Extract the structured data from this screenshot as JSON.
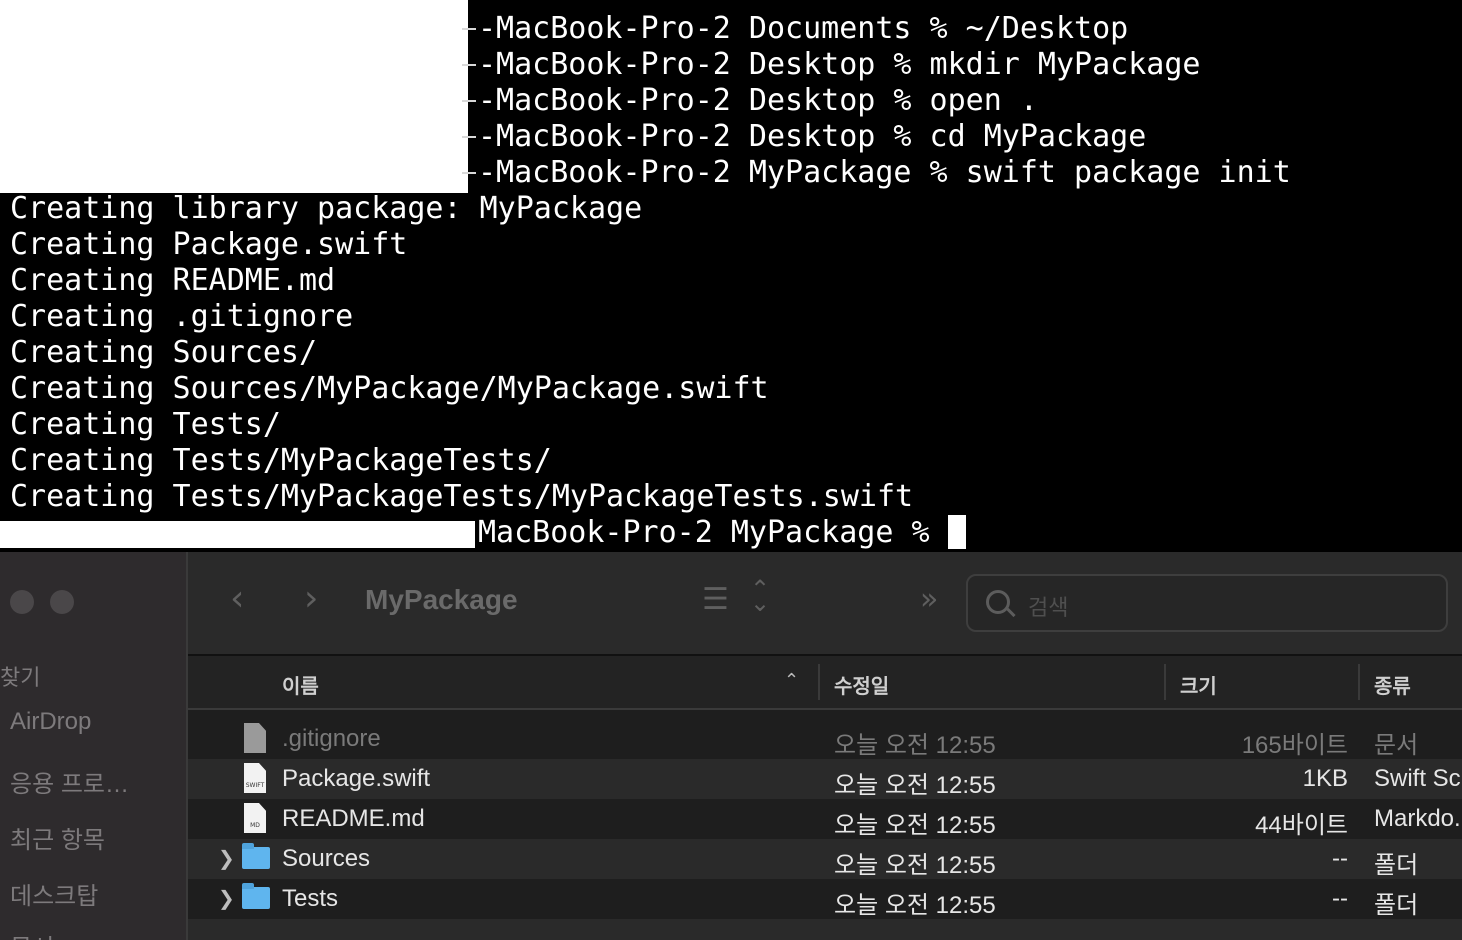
{
  "terminal": {
    "prompt_lines": [
      "-MacBook-Pro-2 Documents % ~/Desktop",
      "-MacBook-Pro-2 Desktop % mkdir MyPackage",
      "-MacBook-Pro-2 Desktop % open .",
      "-MacBook-Pro-2 Desktop % cd MyPackage",
      "-MacBook-Pro-2 MyPackage % swift package init"
    ],
    "output_lines": [
      "Creating library package: MyPackage",
      "Creating Package.swift",
      "Creating README.md",
      "Creating .gitignore",
      "Creating Sources/",
      "Creating Sources/MyPackage/MyPackage.swift",
      "Creating Tests/",
      "Creating Tests/MyPackageTests/",
      "Creating Tests/MyPackageTests/MyPackageTests.swift"
    ],
    "last_prompt": "MacBook-Pro-2 MyPackage %"
  },
  "finder": {
    "sidebar": {
      "heading": "찾기",
      "items": [
        "AirDrop",
        "응용 프로…",
        "최근 항목",
        "데스크탑",
        "문서"
      ]
    },
    "toolbar": {
      "back_icon": "chevron-left-icon",
      "forward_icon": "chevron-right-icon",
      "title": "MyPackage",
      "view_icon": "list-view-icon",
      "more_icon": "double-chevron-icon",
      "search_placeholder": "검색"
    },
    "columns": {
      "name": "이름",
      "modified": "수정일",
      "size": "크기",
      "kind": "종류"
    },
    "files": [
      {
        "name": ".gitignore",
        "modified": "오늘 오전 12:55",
        "size": "165바이트",
        "kind": "문서",
        "icon": "document-icon"
      },
      {
        "name": "Package.swift",
        "modified": "오늘 오전 12:55",
        "size": "1KB",
        "kind": "Swift Sc",
        "icon": "swift-file-icon",
        "tag": "SWIFT"
      },
      {
        "name": "README.md",
        "modified": "오늘 오전 12:55",
        "size": "44바이트",
        "kind": "Markdo.",
        "icon": "markdown-file-icon",
        "tag": "MD"
      },
      {
        "name": "Sources",
        "modified": "오늘 오전 12:55",
        "size": "--",
        "kind": "폴더",
        "icon": "folder-icon"
      },
      {
        "name": "Tests",
        "modified": "오늘 오전 12:55",
        "size": "--",
        "kind": "폴더",
        "icon": "folder-icon"
      }
    ]
  }
}
